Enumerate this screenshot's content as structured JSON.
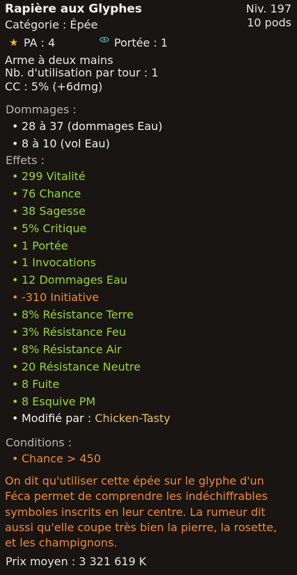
{
  "item": {
    "name": "Rapière aux Glyphes",
    "level": "Niv. 197",
    "weight": "10 pods",
    "category": "Catégorie : Épée",
    "pa_icon": "star-icon",
    "pa": "PA : 4",
    "range_icon": "eye-icon",
    "range": "Portée : 1",
    "two_handed": "Arme à deux mains",
    "uses_per_turn": "Nb. d'utilisation par tour : 1",
    "critical": "CC : 5% (+6dmg)"
  },
  "damages": {
    "title": "Dommages :",
    "lines": [
      "28 à 37 (dommages Eau)",
      "8 à 10 (vol Eau)"
    ]
  },
  "effects": {
    "title": "Effets :",
    "lines": [
      {
        "text": "299 Vitalité",
        "color": "green"
      },
      {
        "text": "76 Chance",
        "color": "green"
      },
      {
        "text": "38 Sagesse",
        "color": "green"
      },
      {
        "text": "5% Critique",
        "color": "green"
      },
      {
        "text": "1 Portée",
        "color": "green"
      },
      {
        "text": "1 Invocations",
        "color": "green"
      },
      {
        "text": "12 Dommages Eau",
        "color": "green"
      },
      {
        "text": "-310 Initiative",
        "color": "orange"
      },
      {
        "text": "8% Résistance Terre",
        "color": "green"
      },
      {
        "text": "3% Résistance Feu",
        "color": "green"
      },
      {
        "text": "8% Résistance Air",
        "color": "green"
      },
      {
        "text": "20 Résistance Neutre",
        "color": "green"
      },
      {
        "text": "8 Fuite",
        "color": "green"
      },
      {
        "text": "8 Esquive PM",
        "color": "green"
      }
    ],
    "modified_label": "Modifié par : ",
    "modified_by": "Chicken-Tasty"
  },
  "conditions": {
    "title": "Conditions :",
    "lines": [
      "Chance > 450"
    ]
  },
  "description": "On dit qu'utiliser cette épée sur le glyphe d'un Féca permet de comprendre les indéchiffrables symboles inscrits en leur centre. La rumeur dit aussi qu'elle coupe très bien la pierre, la rosette, et les champignons.",
  "price": "Prix moyen : 3 321 619 K",
  "colors": {
    "green": "#9ad92a",
    "orange": "#f28a30",
    "yellow": "#e8c25a",
    "section": "#b9b7ae"
  }
}
